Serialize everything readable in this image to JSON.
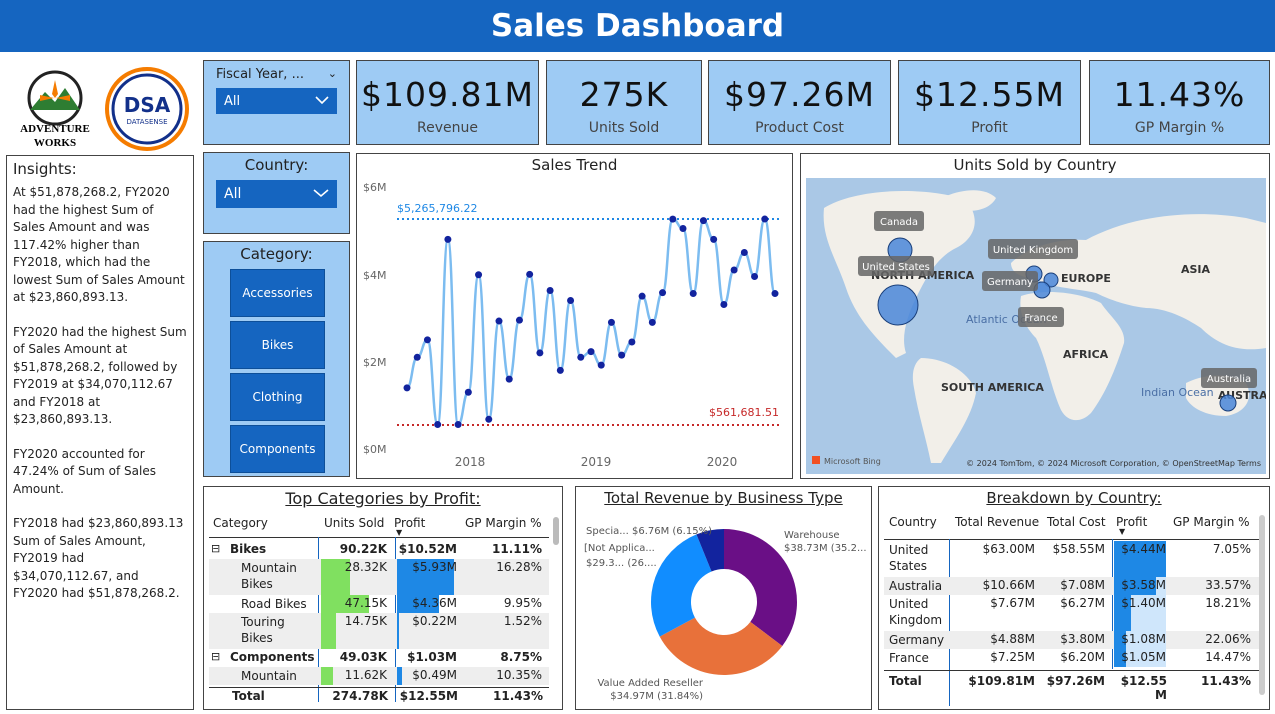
{
  "header": {
    "title": "Sales Dashboard"
  },
  "logos": {
    "aw_line1": "ADVENTURE",
    "aw_line2": "WORKS",
    "dsa": "DSA",
    "dsa_sub": "DATASENSE"
  },
  "insights": {
    "title": "Insights:",
    "p1": "At $51,878,268.2, FY2020 had the highest Sum of Sales Amount and was 117.42% higher than FY2018, which had the lowest Sum of Sales Amount at $23,860,893.13.",
    "p2": "FY2020 had the highest Sum of Sales Amount at $51,878,268.2, followed by FY2019 at $34,070,112.67 and FY2018 at $23,860,893.13.",
    "p3": "FY2020 accounted for 47.24% of Sum of Sales Amount.",
    "p4": "FY2018 had $23,860,893.13 Sum of Sales Amount, FY2019 had $34,070,112.67, and FY2020 had $51,878,268.2."
  },
  "slicers": {
    "fiscal_year": {
      "title": "Fiscal Year, ...",
      "value": "All"
    },
    "country": {
      "title": "Country:",
      "value": "All"
    },
    "category": {
      "title": "Category:",
      "buttons": [
        "Accessories",
        "Bikes",
        "Clothing",
        "Components"
      ]
    }
  },
  "kpis": [
    {
      "value": "$109.81M",
      "label": "Revenue"
    },
    {
      "value": "275K",
      "label": "Units Sold"
    },
    {
      "value": "$97.26M",
      "label": "Product Cost"
    },
    {
      "value": "$12.55M",
      "label": "Profit"
    },
    {
      "value": "11.43%",
      "label": "GP Margin %"
    }
  ],
  "chart_data": {
    "type": "line",
    "title": "Sales Trend",
    "y_ticks": [
      "$6M",
      "$4M",
      "$2M",
      "$0M"
    ],
    "x_ticks": [
      "2018",
      "2019",
      "2020"
    ],
    "ylim": [
      0,
      6000000
    ],
    "max_label": "$5,265,796.22",
    "min_label": "$561,681.51",
    "max_value": 5265796.22,
    "min_value": 561681.51,
    "values": [
      1400000,
      2100000,
      2500000,
      560000,
      4800000,
      560000,
      1300000,
      3990000,
      680000,
      2930000,
      1600000,
      2950000,
      4000000,
      2200000,
      3630000,
      1800000,
      3400000,
      2100000,
      2230000,
      1920000,
      2900000,
      2150000,
      2450000,
      3500000,
      2900000,
      3580000,
      5265000,
      5050000,
      3560000,
      5230000,
      4800000,
      3310000,
      4100000,
      4500000,
      3950000,
      5265796,
      3560000
    ],
    "grid": false
  },
  "map": {
    "title": "Units Sold by Country",
    "labels": {
      "na": "NORTH AMERICA",
      "eu": "EUROPE",
      "asia": "ASIA",
      "africa": "AFRICA",
      "sa": "SOUTH AMERICA",
      "aus": "AUSTRA",
      "atlantic": "Atlantic Ocean",
      "indian": "Indian Ocean"
    },
    "tooltips": [
      "Canada",
      "United States",
      "United Kingdom",
      "Germany",
      "France",
      "Australia"
    ],
    "brand": "Microsoft Bing",
    "credits": "© 2024 TomTom, © 2024 Microsoft Corporation, © OpenStreetMap  Terms"
  },
  "top_categories": {
    "title": "Top Categories by Profit:",
    "headers": [
      "Category",
      "Units Sold",
      "Profit",
      "GP Margin %"
    ],
    "rows": [
      {
        "name": "Bikes",
        "units": "90.22K",
        "profit": "$10.52M",
        "gp": "11.11%",
        "level": 0,
        "toggle": "⊟"
      },
      {
        "name": "Mountain Bikes",
        "units": "28.32K",
        "profit": "$5.93M",
        "gp": "16.28%",
        "level": 1,
        "units_frac": 0.6,
        "profit_frac": 1.0
      },
      {
        "name": "Road Bikes",
        "units": "47.15K",
        "profit": "$4.36M",
        "gp": "9.95%",
        "level": 1,
        "units_frac": 1.0,
        "profit_frac": 0.73
      },
      {
        "name": "Touring Bikes",
        "units": "14.75K",
        "profit": "$0.22M",
        "gp": "1.52%",
        "level": 1,
        "units_frac": 0.31,
        "profit_frac": 0.04
      },
      {
        "name": "Components",
        "units": "49.03K",
        "profit": "$1.03M",
        "gp": "8.75%",
        "level": 0,
        "toggle": "⊟"
      },
      {
        "name": "Mountain",
        "units": "11.62K",
        "profit": "$0.49M",
        "gp": "10.35%",
        "level": 1,
        "units_frac": 0.25,
        "profit_frac": 0.08
      }
    ],
    "total": {
      "name": "Total",
      "units": "274.78K",
      "profit": "$12.55M",
      "gp": "11.43%"
    }
  },
  "donut": {
    "title": "Total Revenue by Business Type",
    "slices": [
      {
        "name": "Warehouse",
        "value": 38.73,
        "label": "Warehouse\n$38.73M (35.2...",
        "color": "#6a0f86"
      },
      {
        "name": "Value Added Reseller",
        "value": 34.97,
        "label": "Value Added Reseller\n$34.97M (31.84%)",
        "color": "#e8713a"
      },
      {
        "name": "[Not Applica...",
        "value": 29.3,
        "label": "[Not Applica...\n$29.3... (26....)",
        "color": "#118dff"
      },
      {
        "name": "Specia...",
        "value": 6.76,
        "label": "Specia... $6.76M (6.15%)",
        "color": "#12239e"
      }
    ],
    "label_warehouse_1": "Warehouse",
    "label_warehouse_2": "$38.73M (35.2...",
    "label_var_1": "Value Added Reseller",
    "label_var_2": "$34.97M (31.84%)",
    "label_na_1": "[Not Applica...",
    "label_na_2": "$29.3... (26....",
    "label_spec": "Specia... $6.76M (6.15%)"
  },
  "breakdown": {
    "title": "Breakdown by Country:",
    "headers": [
      "Country",
      "Total Revenue",
      "Total Cost",
      "Profit",
      "GP Margin %"
    ],
    "rows": [
      {
        "country": "United States",
        "rev": "$63.00M",
        "cost": "$58.55M",
        "profit": "$4.44M",
        "gp": "7.05%",
        "frac": 1.0
      },
      {
        "country": "Australia",
        "rev": "$10.66M",
        "cost": "$7.08M",
        "profit": "$3.58M",
        "gp": "33.57%",
        "frac": 0.81
      },
      {
        "country": "United Kingdom",
        "rev": "$7.67M",
        "cost": "$6.27M",
        "profit": "$1.40M",
        "gp": "18.21%",
        "frac": 0.32
      },
      {
        "country": "Germany",
        "rev": "$4.88M",
        "cost": "$3.80M",
        "profit": "$1.08M",
        "gp": "22.06%",
        "frac": 0.24
      },
      {
        "country": "France",
        "rev": "$7.25M",
        "cost": "$6.20M",
        "profit": "$1.05M",
        "gp": "14.47%",
        "frac": 0.24
      }
    ],
    "total": {
      "country": "Total",
      "rev": "$109.81M",
      "cost": "$97.26M",
      "profit": "$12.55 M",
      "gp": "11.43%"
    }
  }
}
